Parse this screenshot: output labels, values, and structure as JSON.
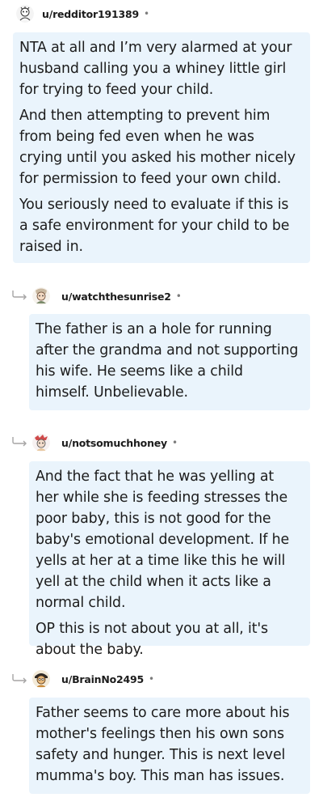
{
  "comments": [
    {
      "username": "u/redditor191389",
      "separator": "•",
      "avatar_icon": "avatar-icon",
      "paragraphs": [
        "NTA at all and I’m very alarmed at your husband calling you a whiney little girl for trying to feed your child.",
        "And then attempting to prevent him from being fed even when he was crying until you asked his mother nicely for permission to feed your own child.",
        "You seriously need to evaluate if this is a safe environment for your child to be raised in."
      ]
    },
    {
      "username": "u/watchthesunrise2",
      "separator": "•",
      "avatar_icon": "avatar-icon",
      "reply_icon": "reply-arrow-icon",
      "paragraphs": [
        "The father is an a hole for running after the grandma and not supporting his wife. He seems like a child himself. Unbelievable."
      ]
    },
    {
      "username": "u/notsomuchhoney",
      "separator": "•",
      "avatar_icon": "avatar-icon",
      "reply_icon": "reply-arrow-icon",
      "paragraphs": [
        "And the fact that he was yelling at her while she is feeding stresses the poor baby, this is not good for the baby's emotional development. If he yells at her at a time like this he will yell at the child when it acts like a normal child.",
        "OP this is not about you at all, it's about the baby."
      ]
    },
    {
      "username": "u/BrainNo2495",
      "separator": "•",
      "avatar_icon": "avatar-icon",
      "reply_icon": "reply-arrow-icon",
      "paragraphs": [
        "Father seems to care more about his mother's feelings then his own sons safety and hunger. This is next level mumma's boy. This man has issues."
      ]
    }
  ],
  "colors": {
    "bubble_background": "#eaf4fc",
    "text": "#1c1c1c",
    "muted": "#7c7c7c"
  }
}
